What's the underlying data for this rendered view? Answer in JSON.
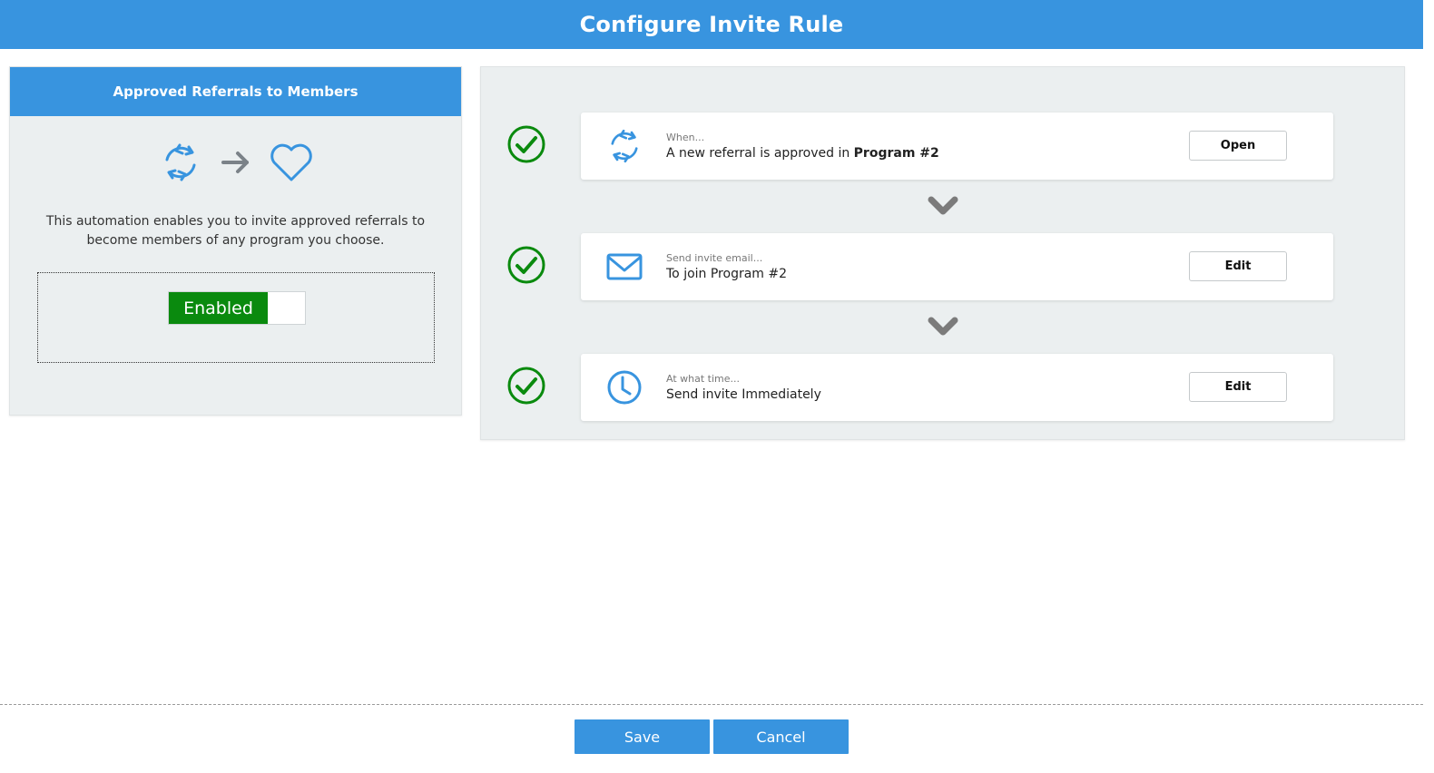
{
  "header": {
    "title": "Configure Invite Rule"
  },
  "rule_card": {
    "title": "Approved Referrals to Members",
    "description": "This automation enables you to invite approved referrals to become members of any program you choose.",
    "toggle_label": "Enabled",
    "toggle_state": "on",
    "icons": [
      "sync-icon",
      "arrow-right-icon",
      "heart-icon"
    ]
  },
  "steps": [
    {
      "status": "complete",
      "icon": "sync-icon",
      "small_label": "When...",
      "main_text": "A new referral is approved in ",
      "main_bold": "Program #2",
      "button": "Open"
    },
    {
      "status": "complete",
      "icon": "envelope-icon",
      "small_label": "Send invite email...",
      "main_text": "To join Program #2",
      "main_bold": "",
      "button": "Edit"
    },
    {
      "status": "complete",
      "icon": "clock-icon",
      "small_label": "At what time...",
      "main_text": "Send invite Immediately",
      "main_bold": "",
      "button": "Edit"
    }
  ],
  "footer": {
    "save_label": "Save",
    "cancel_label": "Cancel"
  },
  "colors": {
    "brand_blue": "#3894df",
    "success_green": "#0a8a0e",
    "panel_bg": "#ebeff0"
  }
}
